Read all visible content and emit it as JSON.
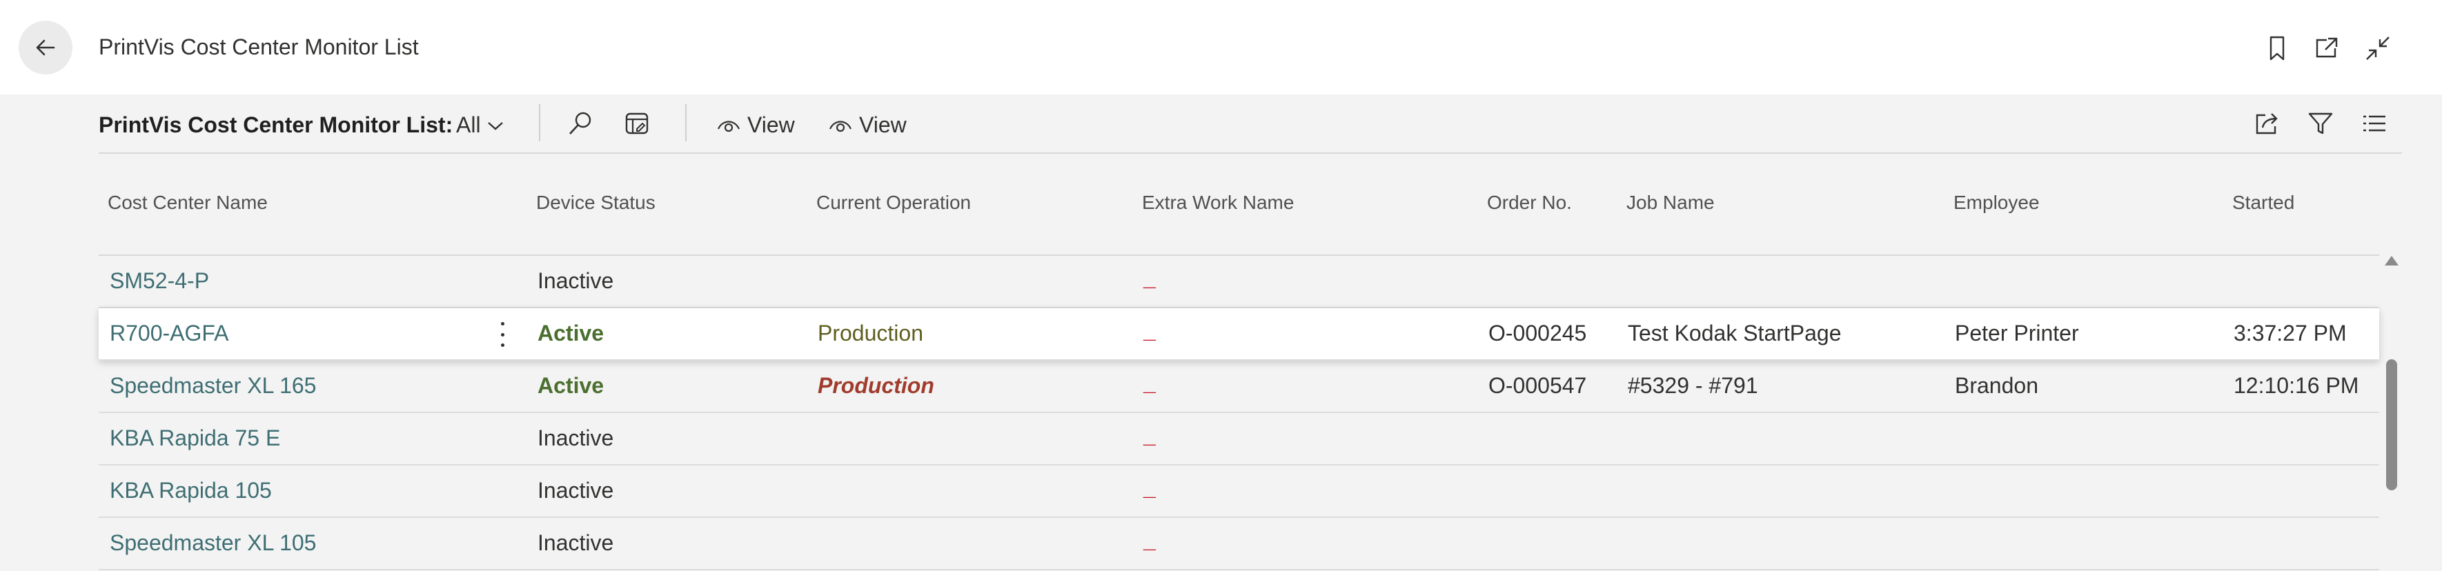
{
  "page": {
    "title": "PrintVis Cost Center Monitor List",
    "icons": [
      "back-arrow-icon",
      "bookmark-icon",
      "open-new-window-icon",
      "collapse-icon"
    ]
  },
  "actionbar": {
    "list_name": "PrintVis Cost Center Monitor List:",
    "view_filter": "All",
    "view1": "View",
    "view2": "View",
    "icons": [
      "search-icon",
      "edit-list-icon",
      "eye-icon",
      "share-icon",
      "filter-icon",
      "list-options-icon"
    ]
  },
  "table": {
    "columns": [
      "Cost Center Name",
      "Device Status",
      "Current Operation",
      "Extra Work Name",
      "Order No.",
      "Job Name",
      "Employee",
      "Started"
    ],
    "rows": [
      {
        "name": "SM52-4-P",
        "status": "Inactive",
        "operation": "",
        "extra": "_",
        "order": "",
        "job": "",
        "employee": "",
        "started": ""
      },
      {
        "name": "R700-AGFA",
        "status": "Active",
        "operation": "Production",
        "extra": "_",
        "order": "O-000245",
        "job": "Test Kodak StartPage",
        "employee": "Peter Printer",
        "started": "3:37:27 PM"
      },
      {
        "name": "Speedmaster XL 165",
        "status": "Active",
        "operation": "Production",
        "extra": "_",
        "order": "O-000547",
        "job": "#5329 - #791",
        "employee": "Brandon",
        "started": "12:10:16 PM"
      },
      {
        "name": "KBA Rapida 75 E",
        "status": "Inactive",
        "operation": "",
        "extra": "_",
        "order": "",
        "job": "",
        "employee": "",
        "started": ""
      },
      {
        "name": "KBA Rapida 105",
        "status": "Inactive",
        "operation": "",
        "extra": "_",
        "order": "",
        "job": "",
        "employee": "",
        "started": ""
      },
      {
        "name": "Speedmaster XL 105",
        "status": "Inactive",
        "operation": "",
        "extra": "_",
        "order": "",
        "job": "",
        "employee": "",
        "started": ""
      }
    ]
  },
  "colors": {
    "name_link": "#3e6e73",
    "active": "#4b6f2f",
    "production": "#5e5e1f",
    "production_alert": "#a03c2c",
    "extra_dash": "#c50f1f"
  }
}
